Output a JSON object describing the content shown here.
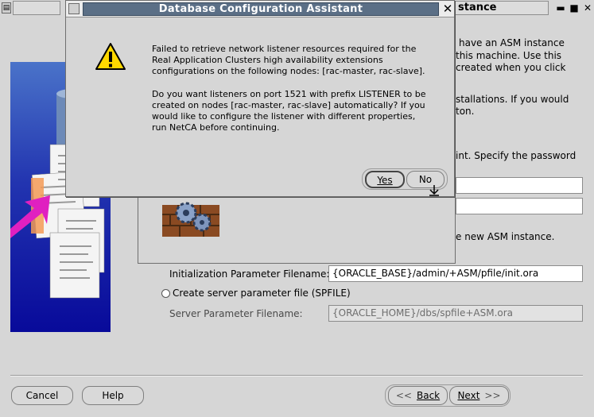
{
  "main_window": {
    "title_fragment": "stance",
    "description_lines": [
      "have an ASM instance",
      "this machine. Use this",
      "created when you click",
      "stallations. If you would",
      "ton.",
      "int. Specify the password",
      "e new ASM instance."
    ],
    "init_param": {
      "label": "Initialization Parameter Filename:",
      "value": "{ORACLE_BASE}/admin/+ASM/pfile/init.ora"
    },
    "spfile_option": {
      "label": "Create server parameter file (SPFILE)"
    },
    "server_param": {
      "label": "Server Parameter Filename:",
      "value": "{ORACLE_HOME}/dbs/spfile+ASM.ora"
    },
    "buttons": {
      "cancel": "Cancel",
      "help": "Help",
      "back": "Back",
      "next": "Next"
    }
  },
  "dialog": {
    "title": "Database Configuration Assistant",
    "icon": "warning-icon",
    "message": [
      "Failed to retrieve network listener resources required for the",
      "Real Application Clusters high availability extensions",
      "configurations on the following nodes: [rac-master, rac-slave].",
      "Do you want listeners on port 1521 with prefix LISTENER to be",
      "created on nodes [rac-master, rac-slave] automatically?  If you",
      "would like to configure the listener with different properties,",
      "run NetCA before continuing."
    ],
    "buttons": {
      "yes": "Yes",
      "no": "No"
    }
  },
  "colors": {
    "title_bar": "#5b6f86",
    "background": "#d6d6d6",
    "warning_yellow": "#ffd800"
  }
}
